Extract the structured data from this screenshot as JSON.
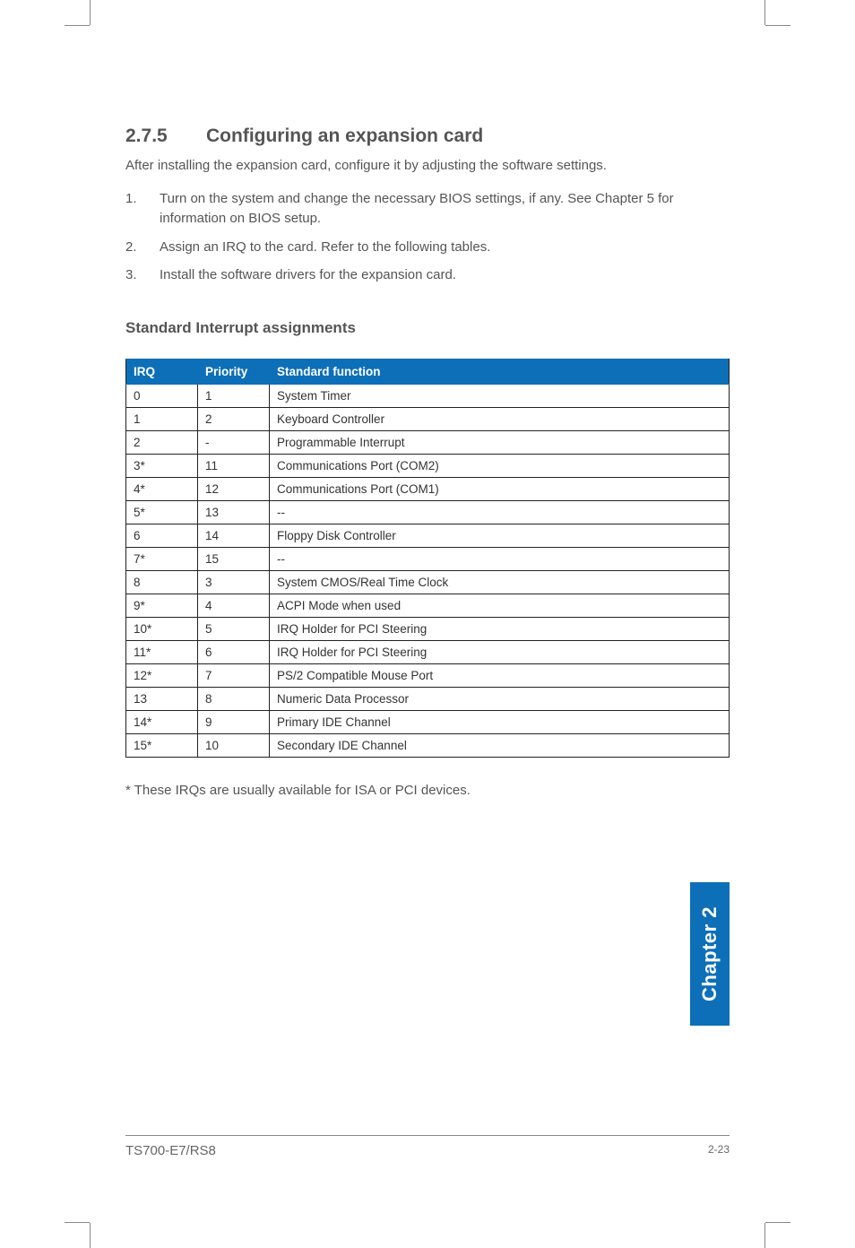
{
  "section": {
    "number": "2.7.5",
    "title": "Configuring an expansion card",
    "intro": "After installing the expansion card, configure it by adjusting the software settings.",
    "steps": [
      {
        "n": "1.",
        "text": "Turn on the system and change the necessary BIOS settings, if any. See Chapter 5 for information on BIOS setup."
      },
      {
        "n": "2.",
        "text": "Assign an IRQ to the card. Refer to the following tables."
      },
      {
        "n": "3.",
        "text": "Install the software drivers for the expansion card."
      }
    ]
  },
  "subheading": "Standard Interrupt assignments",
  "table": {
    "headers": {
      "irq": "IRQ",
      "priority": "Priority",
      "func": "Standard function"
    },
    "rows": [
      {
        "irq": "0",
        "priority": "1",
        "func": "System Timer"
      },
      {
        "irq": "1",
        "priority": "2",
        "func": "Keyboard Controller"
      },
      {
        "irq": "2",
        "priority": "-",
        "func": "Programmable Interrupt"
      },
      {
        "irq": "3*",
        "priority": "11",
        "func": "Communications Port (COM2)"
      },
      {
        "irq": "4*",
        "priority": "12",
        "func": "Communications Port (COM1)"
      },
      {
        "irq": "5*",
        "priority": "13",
        "func": "--"
      },
      {
        "irq": "6",
        "priority": "14",
        "func": "Floppy Disk Controller"
      },
      {
        "irq": "7*",
        "priority": "15",
        "func": "--"
      },
      {
        "irq": "8",
        "priority": "3",
        "func": "System CMOS/Real Time Clock"
      },
      {
        "irq": "9*",
        "priority": "4",
        "func": "ACPI Mode when used"
      },
      {
        "irq": "10*",
        "priority": "5",
        "func": "IRQ Holder for PCI Steering"
      },
      {
        "irq": "11*",
        "priority": "6",
        "func": "IRQ Holder for PCI Steering"
      },
      {
        "irq": "12*",
        "priority": "7",
        "func": "PS/2 Compatible Mouse Port"
      },
      {
        "irq": "13",
        "priority": "8",
        "func": "Numeric Data Processor"
      },
      {
        "irq": "14*",
        "priority": "9",
        "func": "Primary IDE Channel"
      },
      {
        "irq": "15*",
        "priority": "10",
        "func": "Secondary IDE Channel"
      }
    ]
  },
  "footnote": "* These IRQs are usually available for ISA or PCI devices.",
  "chapter_tab": "Chapter 2",
  "footer": {
    "model": "TS700-E7/RS8",
    "page": "2-23"
  }
}
